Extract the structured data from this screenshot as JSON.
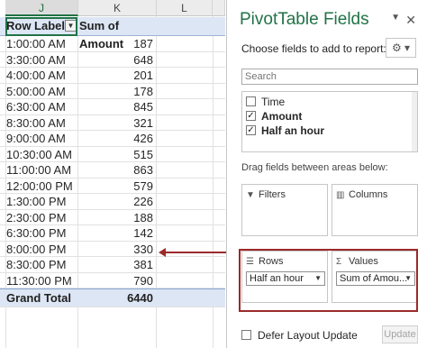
{
  "sheet": {
    "columns": [
      "J",
      "K",
      "L"
    ],
    "header": {
      "row_labels": "Row Labels",
      "sum_label": "Sum of Amount"
    },
    "rows": [
      {
        "time": "1:00:00 AM",
        "amount": "187"
      },
      {
        "time": "3:30:00 AM",
        "amount": "648"
      },
      {
        "time": "4:00:00 AM",
        "amount": "201"
      },
      {
        "time": "5:00:00 AM",
        "amount": "178"
      },
      {
        "time": "6:30:00 AM",
        "amount": "845"
      },
      {
        "time": "8:30:00 AM",
        "amount": "321"
      },
      {
        "time": "9:00:00 AM",
        "amount": "426"
      },
      {
        "time": "10:30:00 AM",
        "amount": "515"
      },
      {
        "time": "11:00:00 AM",
        "amount": "863"
      },
      {
        "time": "12:00:00 PM",
        "amount": "579"
      },
      {
        "time": "1:30:00 PM",
        "amount": "226"
      },
      {
        "time": "2:30:00 PM",
        "amount": "188"
      },
      {
        "time": "6:30:00 PM",
        "amount": "142"
      },
      {
        "time": "8:00:00 PM",
        "amount": "330"
      },
      {
        "time": "8:30:00 PM",
        "amount": "381"
      },
      {
        "time": "11:30:00 PM",
        "amount": "790"
      }
    ],
    "total": {
      "label": "Grand Total",
      "amount": "6440"
    }
  },
  "pane": {
    "title": "PivotTable Fields",
    "choose_label": "Choose fields to add to report:",
    "search_placeholder": "Search",
    "fields": [
      {
        "label": "Time",
        "checked": false
      },
      {
        "label": "Amount",
        "checked": true
      },
      {
        "label": "Half an hour",
        "checked": true
      }
    ],
    "drag_label": "Drag fields between areas below:",
    "areas": {
      "filters": {
        "title": "Filters"
      },
      "columns": {
        "title": "Columns"
      },
      "rows": {
        "title": "Rows",
        "chip": "Half an hour"
      },
      "values": {
        "title": "Values",
        "chip": "Sum of Amou..."
      }
    },
    "defer_label": "Defer Layout Update",
    "update_label": "Update"
  },
  "colors": {
    "accent": "#217346",
    "highlight": "#9c2a2a",
    "pivot_header": "#dde6f4"
  }
}
